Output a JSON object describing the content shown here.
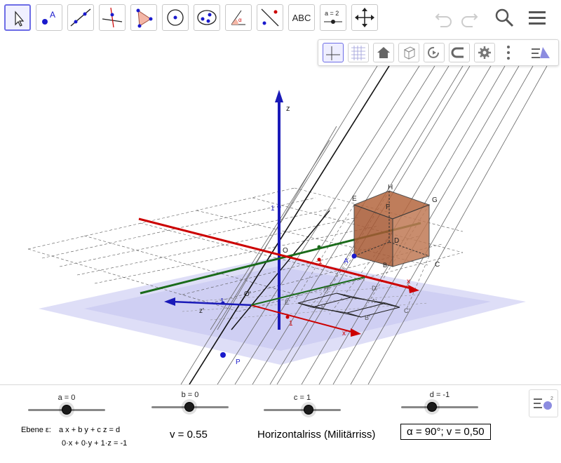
{
  "toolbar": {
    "tools": [
      {
        "name": "move-tool"
      },
      {
        "name": "point-tool",
        "label": "A"
      },
      {
        "name": "line-tool"
      },
      {
        "name": "perpendicular-line-tool"
      },
      {
        "name": "polygon-tool"
      },
      {
        "name": "circle-tool"
      },
      {
        "name": "conic-tool"
      },
      {
        "name": "angle-tool",
        "label": "α"
      },
      {
        "name": "reflect-tool"
      },
      {
        "name": "text-tool",
        "label": "ABC"
      },
      {
        "name": "slider-tool",
        "label": "a = 2"
      },
      {
        "name": "move-graphics-tool"
      }
    ],
    "undo": "undo-icon",
    "redo": "redo-icon",
    "search": "search-icon",
    "menu": "menu-icon"
  },
  "graphics_bar": [
    "axes-icon",
    "grid-icon",
    "home-icon",
    "view-cube-icon",
    "rotate-icon",
    "projection-icon",
    "settings-icon",
    "more-icon",
    "style-bar-icon"
  ],
  "labels": {
    "z": "z",
    "x": "x",
    "origin": "O",
    "one_z": "1",
    "one_x": "1",
    "z_prime": "z'",
    "o_prime": "O'",
    "one_zp": "1",
    "one_xp": "1",
    "x_prime": "x'",
    "E": "E",
    "H": "H",
    "G": "G",
    "F": "F",
    "D": "D",
    "A": "A",
    "B": "B",
    "C": "C",
    "E_p": "E'",
    "H_p": "H'",
    "D_p": "D'",
    "F_p": "F'",
    "G_p": "G'",
    "A_p": "A'",
    "B_p": "B'",
    "C_p": "C'",
    "P": "P"
  },
  "sliders": [
    {
      "label": "a = 0",
      "value": 0
    },
    {
      "label": "b = 0",
      "value": 0
    },
    {
      "label": "c = 1",
      "value": 1
    },
    {
      "label": "d = -1",
      "value": -1
    }
  ],
  "texts": {
    "plane_label": "Ebene ε:",
    "plane_eq": "a x + b y + c z = d",
    "plane_inst": "0·x + 0·y + 1·z = -1",
    "v_value": "v = 0.55",
    "projection_name": "Horizontalriss (Militärriss)",
    "angle_box": "α = 90°; v = 0,50"
  },
  "colors": {
    "x_axis": "#cc0000",
    "y_axis": "#1a6b1a",
    "z_axis": "#1a1ab8",
    "plane": "#b8b8f0",
    "cube": "#a0522d",
    "point": "#1a1acc"
  }
}
